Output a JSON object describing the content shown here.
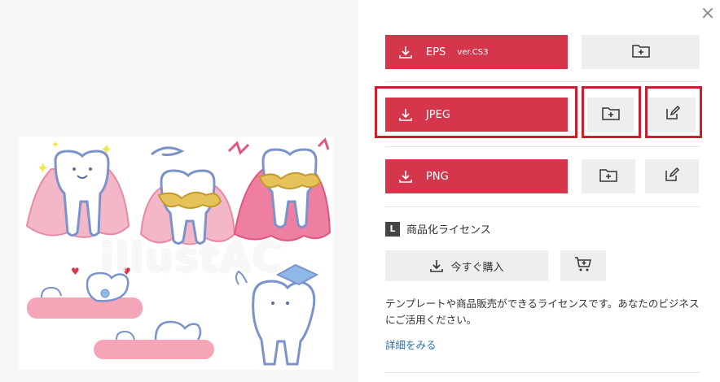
{
  "preview": {
    "watermark": "illustAC"
  },
  "close_icon": "×",
  "downloads": [
    {
      "format": "EPS",
      "version": "ver.CS3"
    },
    {
      "format": "JPEG"
    },
    {
      "format": "PNG"
    }
  ],
  "license": {
    "badge": "L",
    "title": "商品化ライセンス",
    "buy_label": "今すぐ購入",
    "description": "テンプレートや商品販売ができるライセンスです。あなたのビジネスにご活用ください。",
    "more_link": "詳細をみる"
  },
  "colors": {
    "accent": "#d6364b",
    "highlight": "#c8202f",
    "button_gray": "#eeeeee",
    "link": "#2b6fb3"
  },
  "icons": [
    "download-icon",
    "folder-add-icon",
    "edit-icon",
    "cart-add-icon",
    "close-icon"
  ]
}
